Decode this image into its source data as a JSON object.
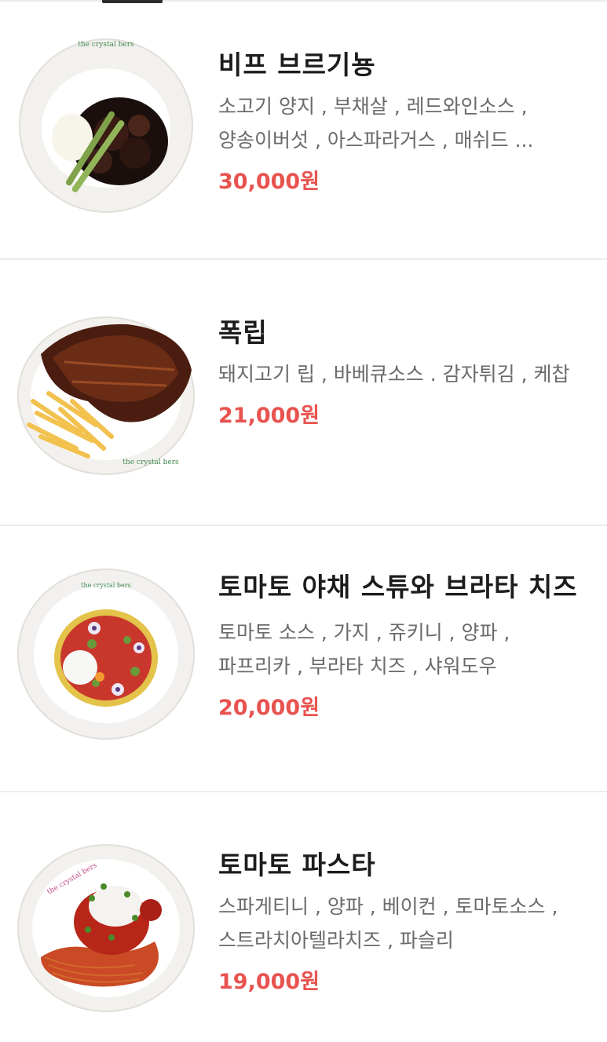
{
  "menu": {
    "items": [
      {
        "name": "비프 브르기뇽",
        "description": "소고기 양지 , 부채살 , 레드와인소스 , 양송이버섯 , 아스파라거스 , 매쉬드 ...",
        "price": "30,000원",
        "image_icon": "beef-bourguignon-dish-icon",
        "plate_logo": "the crystal bers"
      },
      {
        "name": "폭립",
        "description": "돼지고기 립 , 바베큐소스 . 감자튀김 , 케찹",
        "price": "21,000원",
        "image_icon": "pork-ribs-dish-icon",
        "plate_logo": "the crystal bers"
      },
      {
        "name": "토마토 야채 스튜와 브라타 치즈",
        "description": "토마토 소스 , 가지 , 쥬키니 , 양파 , 파프리카 , 부라타 치즈 , 샤워도우",
        "price": "20,000원",
        "image_icon": "tomato-stew-dish-icon",
        "plate_logo": "the crystal bers"
      },
      {
        "name": "토마토 파스타",
        "description": "스파게티니 , 양파 , 베이컨 , 토마토소스 , 스트라치아텔라치즈 , 파슬리",
        "price": "19,000원",
        "image_icon": "tomato-pasta-dish-icon",
        "plate_logo": "the crystal bers"
      }
    ]
  },
  "colors": {
    "price": "#e8534f",
    "title": "#1c1c1c",
    "description": "#6a6a6a",
    "divider": "#ececec"
  }
}
